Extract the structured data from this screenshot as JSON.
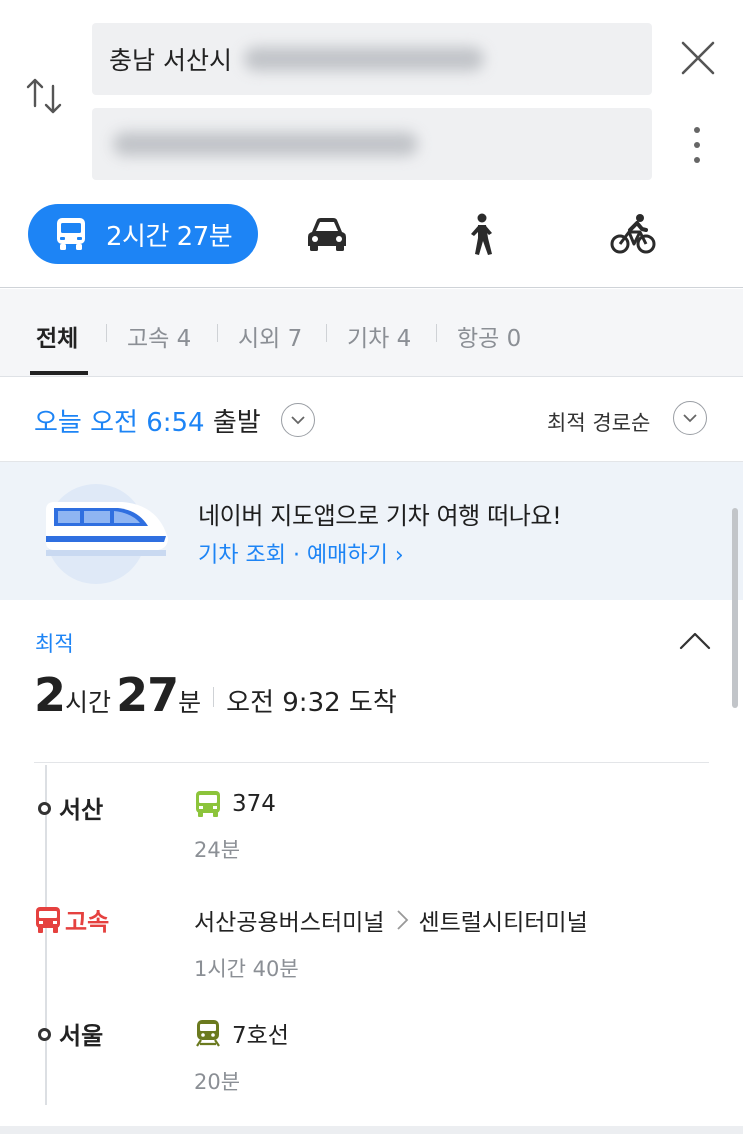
{
  "search": {
    "origin_text": "충남 서산시",
    "destination_text": ""
  },
  "modes": {
    "active_label": "2시간 27분",
    "items": [
      "bus-icon",
      "car-icon",
      "walk-icon",
      "bicycle-icon"
    ]
  },
  "tabs": [
    {
      "label": "전체"
    },
    {
      "label": "고속 4"
    },
    {
      "label": "시외 7"
    },
    {
      "label": "기차 4"
    },
    {
      "label": "항공 0"
    }
  ],
  "departure": {
    "time": "오늘 오전 6:54",
    "suffix": "출발",
    "sort_label": "최적 경로순"
  },
  "banner": {
    "title": "네이버 지도앱으로 기차 여행 떠나요!",
    "link": "기차 조회 · 예매하기 ›"
  },
  "route": {
    "badge": "최적",
    "hours": "2",
    "hours_unit": "시간",
    "minutes": "27",
    "minutes_unit": "분",
    "arrival": "오전 9:32 도착",
    "stops": [
      {
        "label": "서산",
        "type": "dot"
      },
      {
        "label": "고속",
        "type": "express-bus"
      },
      {
        "label": "서울",
        "type": "dot"
      }
    ],
    "legs": [
      {
        "main": "374",
        "sub": "24분",
        "icon": "bus-icon",
        "color": "#8cc43b"
      },
      {
        "from": "서산공용버스터미널",
        "to": "센트럴시티터미널",
        "sub": "1시간 40분"
      },
      {
        "main": "7호선",
        "sub": "20분",
        "icon": "subway-icon",
        "color": "#6b7a1f"
      }
    ]
  },
  "colors": {
    "accent": "#1d84f5",
    "express": "#e5413f",
    "text": "#222222"
  }
}
